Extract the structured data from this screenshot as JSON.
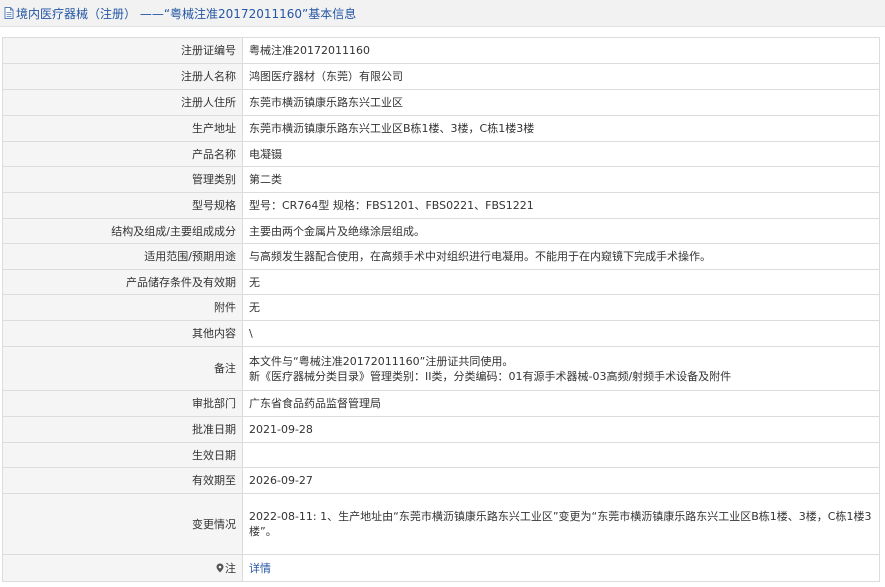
{
  "title": "境内医疗器械（注册） ——“粤械注准20172011160”基本信息",
  "rows": [
    {
      "label": "注册证编号",
      "lines": [
        "粤械注准20172011160"
      ],
      "h": 26
    },
    {
      "label": "注册人名称",
      "lines": [
        "鸿图医疗器材（东莞）有限公司"
      ],
      "h": 26
    },
    {
      "label": "注册人住所",
      "lines": [
        "东莞市横沥镇康乐路东兴工业区"
      ],
      "h": 26
    },
    {
      "label": "生产地址",
      "lines": [
        "东莞市横沥镇康乐路东兴工业区B栋1楼、3楼，C栋1楼3楼"
      ],
      "h": 26
    },
    {
      "label": "产品名称",
      "lines": [
        "电凝镊"
      ],
      "h": 25
    },
    {
      "label": "管理类别",
      "lines": [
        "第二类"
      ],
      "h": 26
    },
    {
      "label": "型号规格",
      "lines": [
        "型号：CR764型 规格：FBS1201、FBS0221、FBS1221"
      ],
      "h": 26
    },
    {
      "label": "结构及组成/主要组成成分",
      "lines": [
        "主要由两个金属片及绝缘涂层组成。"
      ],
      "h": 25
    },
    {
      "label": "适用范围/预期用途",
      "lines": [
        "与高频发生器配合使用，在高频手术中对组织进行电凝用。不能用于在内窥镜下完成手术操作。"
      ],
      "h": 26
    },
    {
      "label": "产品储存条件及有效期",
      "lines": [
        "无"
      ],
      "h": 25
    },
    {
      "label": "附件",
      "lines": [
        "无"
      ],
      "h": 26
    },
    {
      "label": "其他内容",
      "lines": [
        "\\"
      ],
      "h": 26
    },
    {
      "label": "备注",
      "lines": [
        "本文件与“粤械注准20172011160”注册证共同使用。",
        "新《医疗器械分类目录》管理类别：II类，分类编码：01有源手术器械-03高频/射频手术设备及附件"
      ],
      "h": 44
    },
    {
      "label": "审批部门",
      "lines": [
        "广东省食品药品监督管理局"
      ],
      "h": 26
    },
    {
      "label": "批准日期",
      "lines": [
        "2021-09-28"
      ],
      "h": 26
    },
    {
      "label": "生效日期",
      "lines": [
        ""
      ],
      "h": 25
    },
    {
      "label": "有效期至",
      "lines": [
        "2026-09-27"
      ],
      "h": 26
    },
    {
      "label": "变更情况",
      "lines": [
        "2022-08-11: 1、生产地址由“东莞市横沥镇康乐路东兴工业区”变更为“东莞市横沥镇康乐路东兴工业区B栋1楼、3楼，C栋1楼3",
        "楼”。"
      ],
      "h": 61
    },
    {
      "label": "注",
      "lines": [
        "详情"
      ],
      "h": 27,
      "icon": "pin-icon",
      "link": true
    }
  ],
  "colors": {
    "title": "#2456a4",
    "link": "#2456a4",
    "label_bg": "#f5f5f5",
    "border": "#dcdcdc"
  }
}
